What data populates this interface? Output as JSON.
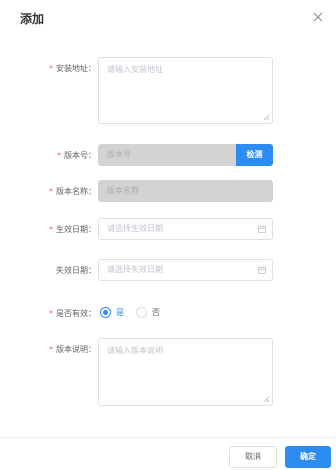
{
  "dialog": {
    "title": "添加",
    "close_icon": "close-icon"
  },
  "form": {
    "install_address": {
      "required": "*",
      "label": "安装地址：",
      "placeholder": "请输入安装地址"
    },
    "version_number": {
      "required": "*",
      "label": "版本号：",
      "placeholder": "版本号",
      "check_button": "检测"
    },
    "version_name": {
      "required": "*",
      "label": "版本名称：",
      "placeholder": "版本名称"
    },
    "effective_date": {
      "required": "*",
      "label": "生效日期：",
      "placeholder": "请选择生效日期",
      "icon": "calendar-icon"
    },
    "expiry_date": {
      "label": "失效日期：",
      "placeholder": "请选择失效日期",
      "icon": "calendar-icon"
    },
    "is_valid": {
      "required": "*",
      "label": "是否有效：",
      "options": [
        "是",
        "否"
      ],
      "selected": "是"
    },
    "version_description": {
      "required": "*",
      "label": "版本说明：",
      "placeholder": "请输入版本说明"
    }
  },
  "footer": {
    "cancel_label": "取消",
    "ok_label": "确定"
  },
  "colors": {
    "primary": "#2d8cf0",
    "required": "#f56c6c",
    "disabled_bg": "#d3d3d3"
  }
}
